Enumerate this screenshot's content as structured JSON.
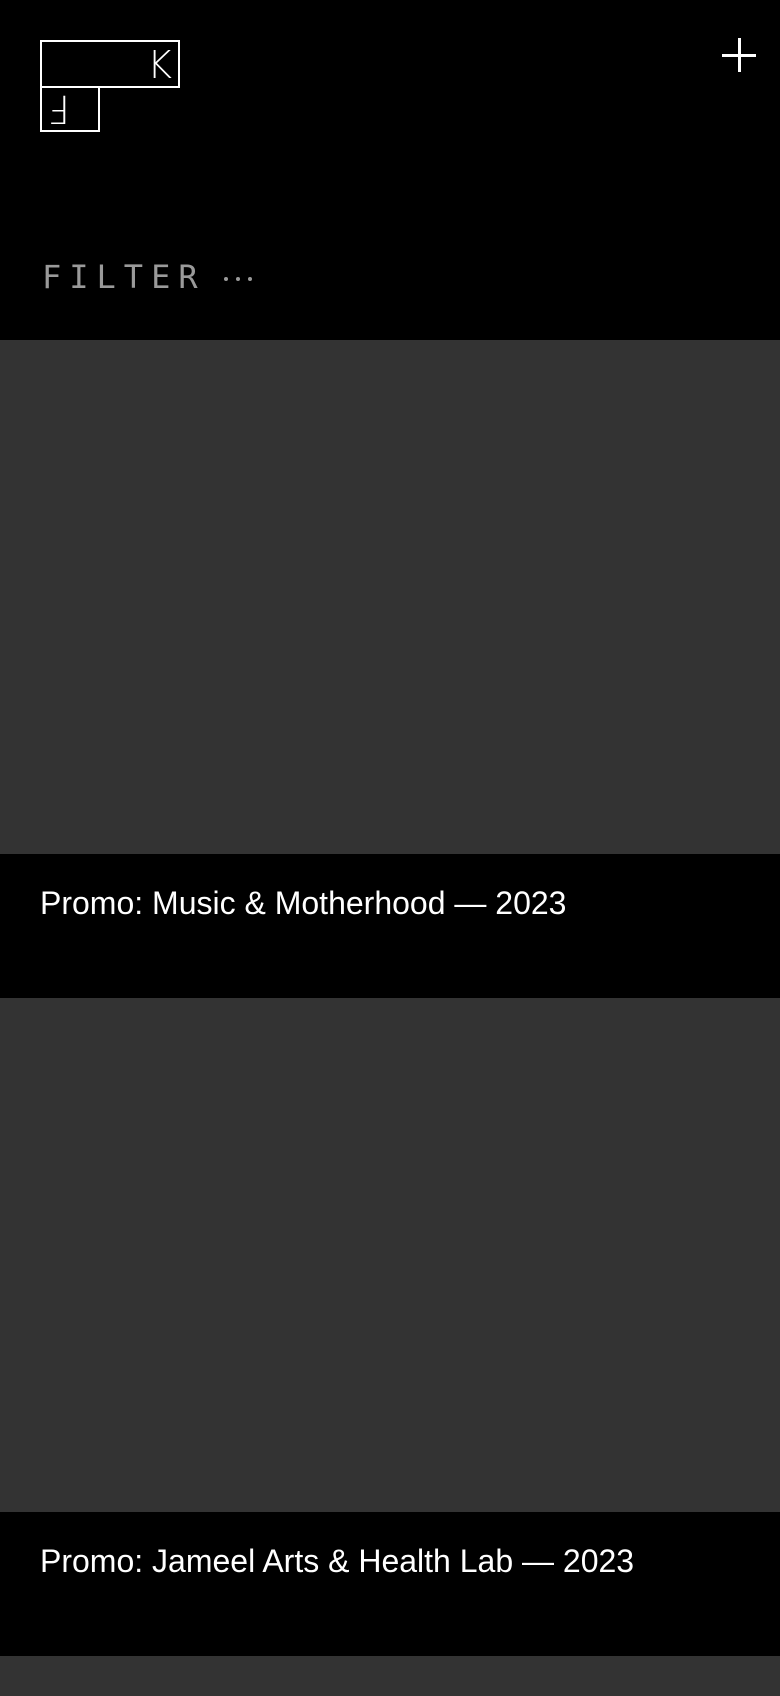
{
  "header": {
    "logo": {
      "letter_top": "K",
      "letter_bottom": "F"
    },
    "menu_icon": "plus-icon"
  },
  "filter": {
    "label": "FILTER",
    "icon": "more-dots-icon"
  },
  "cards": [
    {
      "title": "Promo: Music & Motherhood — 2023",
      "media_color": "#333333"
    },
    {
      "title": "Promo: Jameel Arts & Health Lab — 2023",
      "media_color": "#333333"
    }
  ],
  "colors": {
    "background": "#000000",
    "placeholder": "#333333",
    "text": "#ffffff",
    "muted": "#9a9a9a"
  }
}
